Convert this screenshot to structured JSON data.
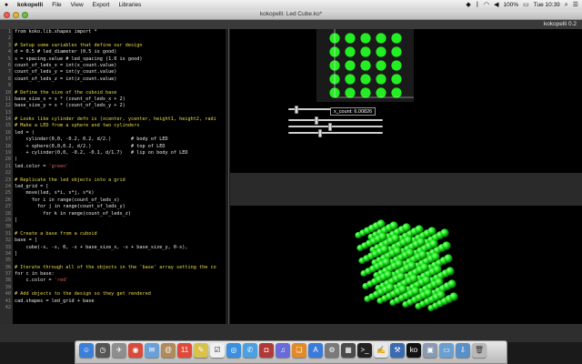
{
  "menubar": {
    "app": "kokopelli",
    "items": [
      "File",
      "View",
      "Export",
      "Libraries"
    ],
    "battery": "100%",
    "clock": "Tue 10:39"
  },
  "window": {
    "title": "kokopelli: Led Cube.ko*"
  },
  "app_header": {
    "name": "kokopelli 0.2"
  },
  "editor": {
    "lines": [
      {
        "n": "1",
        "text": "from koko.lib.shapes import *",
        "kind": "code"
      },
      {
        "n": "2",
        "text": "",
        "kind": "code"
      },
      {
        "n": "3",
        "text": "# Setup some variables that define our design",
        "kind": "comment"
      },
      {
        "n": "4",
        "text": "d = 0.5 # led_diameter (0.5 is good)",
        "kind": "code"
      },
      {
        "n": "5",
        "text": "s = spacing.value # led_spacing (1.0 is good)",
        "kind": "code"
      },
      {
        "n": "6",
        "text": "count_of_leds_x = int(x_count.value)",
        "kind": "code"
      },
      {
        "n": "7",
        "text": "count_of_leds_y = int(y_count.value)",
        "kind": "code"
      },
      {
        "n": "8",
        "text": "count_of_leds_z = int(z_count.value)",
        "kind": "code"
      },
      {
        "n": "9",
        "text": "",
        "kind": "code"
      },
      {
        "n": "10",
        "text": "# Define the size of the cuboid base",
        "kind": "comment"
      },
      {
        "n": "11",
        "text": "base_size_x = s * (count_of_leds_x + 2)",
        "kind": "code"
      },
      {
        "n": "12",
        "text": "base_size_y = s * (count_of_leds_y + 2)",
        "kind": "code"
      },
      {
        "n": "13",
        "text": "",
        "kind": "code"
      },
      {
        "n": "14",
        "text": "# Looks like cylinder defn is (xcenter, ycenter, height1, height2, radi",
        "kind": "comment"
      },
      {
        "n": "15",
        "text": "# Make a LED from a sphere and two cylinders",
        "kind": "comment"
      },
      {
        "n": "16",
        "text": "led = (",
        "kind": "code"
      },
      {
        "n": "17",
        "text": "    cylinder(0,0, -0.2, 0.2, d/2.)       # body of LED",
        "kind": "code"
      },
      {
        "n": "18",
        "text": "    + sphere(0,0,0.2, d/2.)              # top of LED",
        "kind": "code"
      },
      {
        "n": "19",
        "text": "    + cylinder(0,0, -0.2, -0.1, d/1.7)   # lip on body of LED",
        "kind": "code"
      },
      {
        "n": "20",
        "text": ")",
        "kind": "code"
      },
      {
        "n": "21",
        "text": "led.color = ",
        "str": "'green'",
        "kind": "code"
      },
      {
        "n": "22",
        "text": "",
        "kind": "code"
      },
      {
        "n": "23",
        "text": "# Replicate the led objects into a grid",
        "kind": "comment"
      },
      {
        "n": "24",
        "text": "led_grid = [",
        "kind": "code"
      },
      {
        "n": "25",
        "text": "    move(led, s*i, s*j, s*k)",
        "kind": "code"
      },
      {
        "n": "26",
        "text": "      for i in range(count_of_leds_x)",
        "kind": "code"
      },
      {
        "n": "27",
        "text": "        for j in range(count_of_leds_y)",
        "kind": "code"
      },
      {
        "n": "28",
        "text": "          for k in range(count_of_leds_z)",
        "kind": "code"
      },
      {
        "n": "29",
        "text": "]",
        "kind": "code"
      },
      {
        "n": "30",
        "text": "",
        "kind": "code"
      },
      {
        "n": "31",
        "text": "# Create a base from a cuboid",
        "kind": "comment"
      },
      {
        "n": "32",
        "text": "base = [",
        "kind": "code"
      },
      {
        "n": "33",
        "text": "    cube(-s, -s, 0, -s + base_size_x, -s + base_size_y, 0-s),",
        "kind": "code"
      },
      {
        "n": "34",
        "text": "]",
        "kind": "code"
      },
      {
        "n": "35",
        "text": "",
        "kind": "code"
      },
      {
        "n": "36",
        "text": "# Iterate through all of the objects in the 'base' array setting the co",
        "kind": "comment"
      },
      {
        "n": "37",
        "text": "for c in base:",
        "kind": "code"
      },
      {
        "n": "38",
        "text": "    c.color = ",
        "str": "'red'",
        "kind": "code"
      },
      {
        "n": "39",
        "text": "",
        "kind": "code"
      },
      {
        "n": "40",
        "text": "# Add objects to the design so they get rendered",
        "kind": "comment"
      },
      {
        "n": "41",
        "text": "cad.shapes = led_grid + base",
        "kind": "code"
      },
      {
        "n": "42",
        "text": "",
        "kind": "code"
      }
    ]
  },
  "viewport": {
    "slider_tooltip": "x_count: 6.00826",
    "led_color": "#22ee22",
    "slider_levels": [
      0.12,
      0.28,
      0.42,
      0.32
    ]
  },
  "dock": {
    "icons": [
      {
        "name": "finder-icon",
        "color": "#3b7fd9",
        "glyph": "☺"
      },
      {
        "name": "dashboard-icon",
        "color": "#555555",
        "glyph": "◷"
      },
      {
        "name": "launchpad-icon",
        "color": "#8e8e8e",
        "glyph": "✈"
      },
      {
        "name": "chrome-icon",
        "color": "#d94a3b",
        "glyph": "◉"
      },
      {
        "name": "mail-icon",
        "color": "#6aa0d8",
        "glyph": "✉"
      },
      {
        "name": "contacts-icon",
        "color": "#b08a5a",
        "glyph": "@"
      },
      {
        "name": "calendar-icon",
        "color": "#e04a3a",
        "glyph": "11"
      },
      {
        "name": "notes-icon",
        "color": "#d9c24a",
        "glyph": "✎"
      },
      {
        "name": "reminders-icon",
        "color": "#f0f0f0",
        "glyph": "☑"
      },
      {
        "name": "safari-icon",
        "color": "#3a8fe0",
        "glyph": "◎"
      },
      {
        "name": "messages-icon",
        "color": "#4aa0e0",
        "glyph": "✆"
      },
      {
        "name": "photobooth-icon",
        "color": "#b03a3a",
        "glyph": "◘"
      },
      {
        "name": "itunes-icon",
        "color": "#6a6ad9",
        "glyph": "♫"
      },
      {
        "name": "ibooks-icon",
        "color": "#e08a2a",
        "glyph": "❏"
      },
      {
        "name": "appstore-icon",
        "color": "#3a7ad9",
        "glyph": "A"
      },
      {
        "name": "preferences-icon",
        "color": "#7a7a7a",
        "glyph": "⚙"
      },
      {
        "name": "activity-icon",
        "color": "#4a4a4a",
        "glyph": "▦"
      },
      {
        "name": "terminal-icon",
        "color": "#222222",
        "glyph": ">_"
      },
      {
        "name": "textedit-icon",
        "color": "#e8e8e8",
        "glyph": "✍"
      },
      {
        "name": "xcode-icon",
        "color": "#3a6ab0",
        "glyph": "⚒"
      },
      {
        "name": "kokopelli-icon",
        "color": "#111111",
        "glyph": "ko"
      },
      {
        "name": "preview-icon",
        "color": "#8a9ab0",
        "glyph": "▣"
      },
      {
        "name": "folder-icon",
        "color": "#6aa0d0",
        "glyph": "▭"
      },
      {
        "name": "downloads-icon",
        "color": "#5a90c8",
        "glyph": "⇩"
      },
      {
        "name": "trash-icon",
        "color": "#b8b8b8",
        "glyph": "🗑"
      }
    ]
  }
}
